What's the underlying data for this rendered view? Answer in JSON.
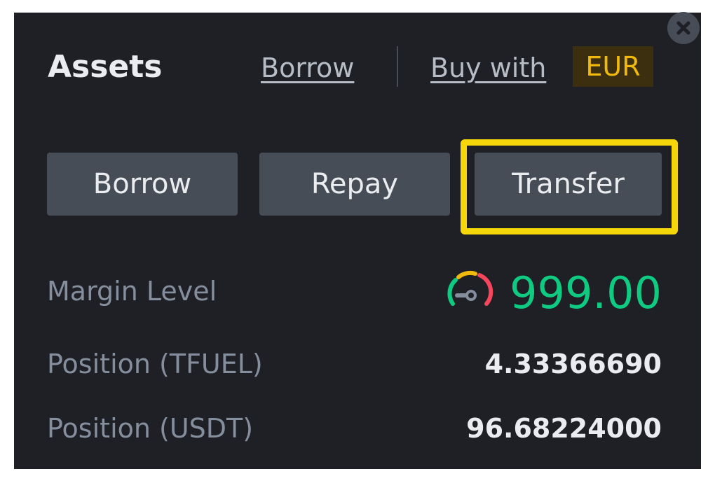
{
  "header": {
    "title": "Assets",
    "borrow_link": "Borrow",
    "buy_with_link": "Buy with",
    "currency": "EUR"
  },
  "actions": {
    "borrow_label": "Borrow",
    "repay_label": "Repay",
    "transfer_label": "Transfer"
  },
  "stats": {
    "margin_level_label": "Margin Level",
    "margin_level_value": "999.00",
    "position_tfuel_label": "Position (TFUEL)",
    "position_tfuel_value": "4.33366690",
    "position_usdt_label": "Position (USDT)",
    "position_usdt_value": "96.68224000"
  },
  "icons": {
    "close": "close-icon",
    "gauge": "margin-gauge-icon"
  },
  "colors": {
    "panel_bg": "#1e2026",
    "accent_yellow": "#f0b90b",
    "highlight": "#f5d60a",
    "positive_green": "#0ecb81"
  }
}
